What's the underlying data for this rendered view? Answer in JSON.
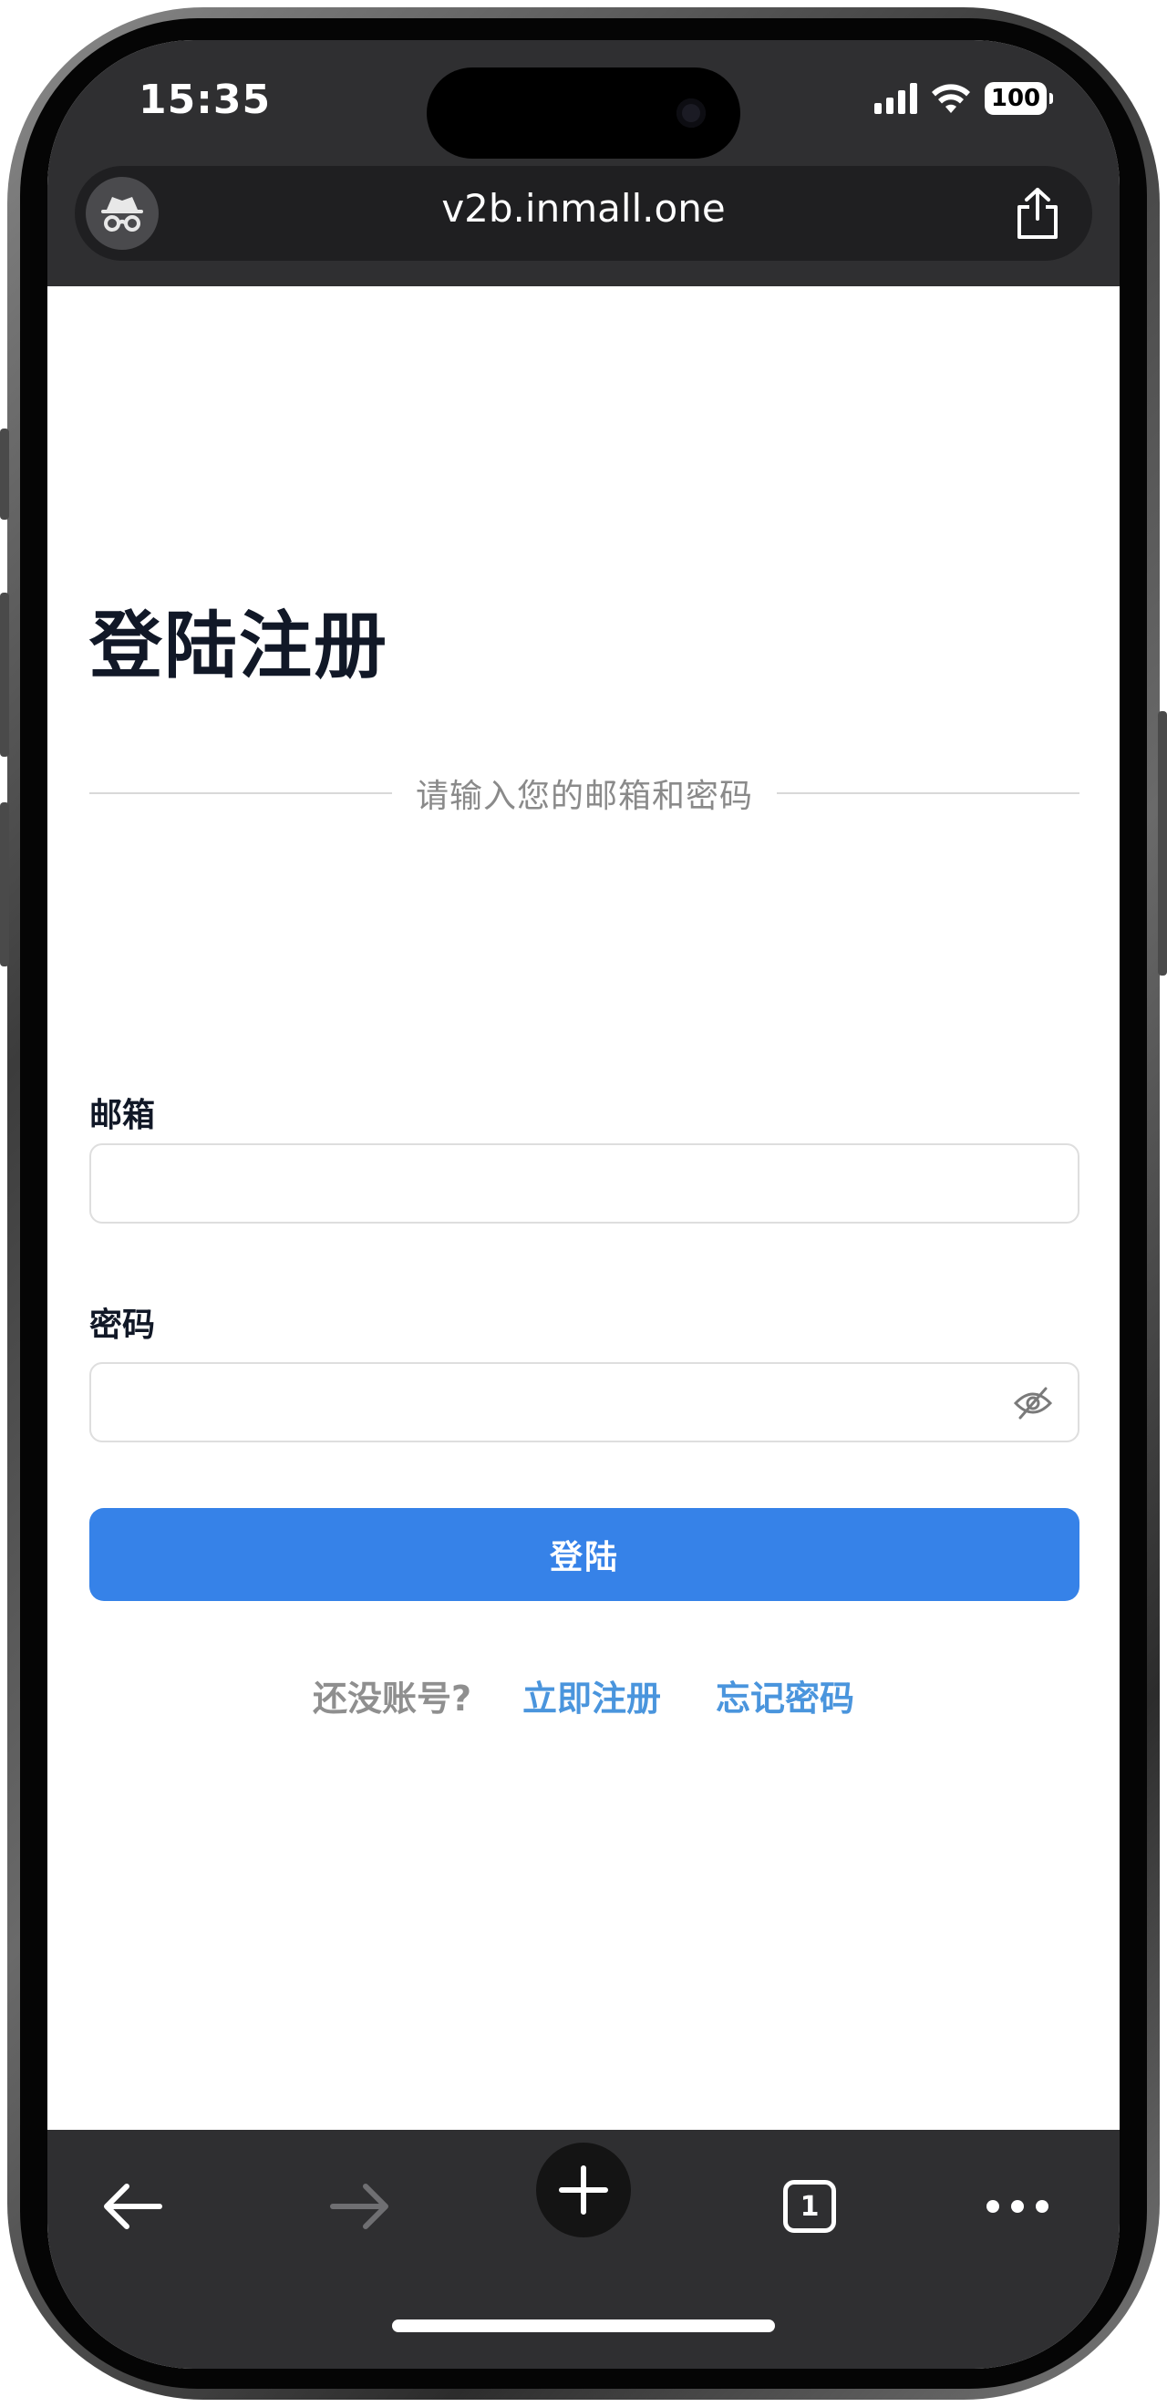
{
  "status_bar": {
    "time": "15:35",
    "battery": "100"
  },
  "browser": {
    "url": "v2b.inmall.one",
    "tab_count": "1"
  },
  "page": {
    "title": "登陆注册",
    "subtitle": "请输入您的邮箱和密码",
    "email_label": "邮箱",
    "email_value": "",
    "password_label": "密码",
    "password_value": "",
    "login_button": "登陆",
    "no_account_text": "还没账号?",
    "register_link": "立即注册",
    "forgot_link": "忘记密码"
  },
  "icons": {
    "incognito": "incognito-icon",
    "share": "share-icon",
    "eye_hidden": "eye-off-icon",
    "back": "arrow-left-icon",
    "forward": "arrow-right-icon",
    "new_tab": "plus-icon",
    "tabs": "tabs-icon",
    "more": "more-icon"
  },
  "colors": {
    "primary": "#3682e8",
    "link": "#4a95dd",
    "browser_chrome": "#2f2f31"
  }
}
